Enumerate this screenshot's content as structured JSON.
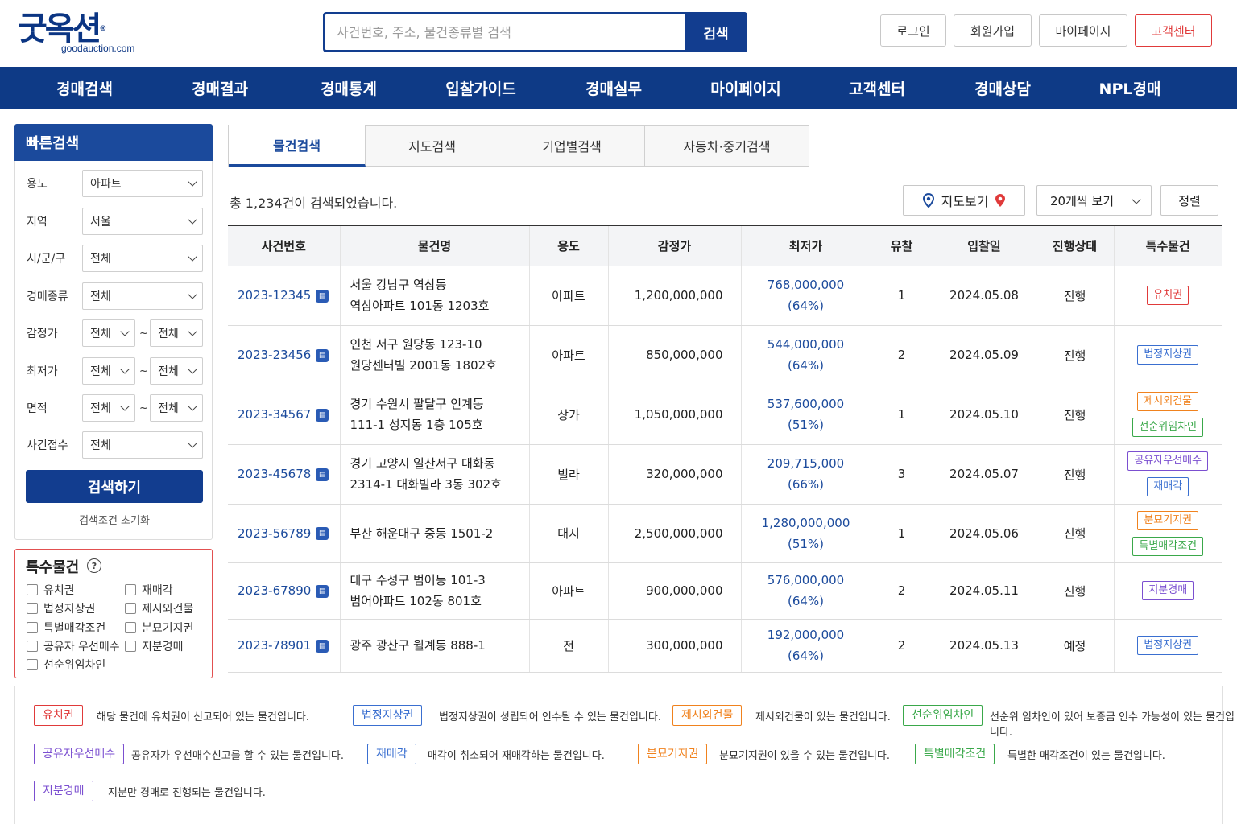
{
  "colors": {
    "brand_navy": "#0e3a86",
    "accent_blue": "#1b4a9c",
    "red": "#e03a3a",
    "tag_red": "#e03a3a",
    "tag_blue": "#3a6fd0",
    "tag_orange": "#f0821e",
    "tag_green": "#3aa84a",
    "tag_purple": "#7b4fd0"
  },
  "header": {
    "logo_main": "굿옥션",
    "logo_reg": "®",
    "logo_sub": "goodauction.com",
    "search_placeholder": "사건번호, 주소, 물건종류별 검색",
    "search_button": "검색",
    "login": "로그인",
    "signup": "회원가입",
    "mypage": "마이페이지",
    "support": "고객센터"
  },
  "nav": [
    "경매검색",
    "경매결과",
    "경매통계",
    "입찰가이드",
    "경매실무",
    "마이페이지",
    "고객센터",
    "경매상담",
    "NPL경매"
  ],
  "sidebar": {
    "title": "빠른검색",
    "usage_label": "용도",
    "usage_value": "아파트",
    "region_label": "지역",
    "region_value": "서울",
    "district_label": "시/군/구",
    "district_value": "전체",
    "type_label": "경매종류",
    "type_value": "전체",
    "appraisal_label": "감정가",
    "appraisal_from": "전체",
    "appraisal_to": "전체",
    "minprice_label": "최저가",
    "minprice_from": "전체",
    "minprice_to": "전체",
    "area_label": "면적",
    "area_from": "전체",
    "area_to": "전체",
    "received_label": "사건접수",
    "received_value": "전체",
    "tilde": "~",
    "search_button": "검색하기",
    "reset": "검색조건 초기화"
  },
  "special": {
    "title": "특수물건",
    "help_icon": "question-circle-icon",
    "items": [
      "유치권",
      "재매각",
      "법정지상권",
      "제시외건물",
      "특별매각조건",
      "분묘기지권",
      "공유자 우선매수",
      "지분경매",
      "선순위임차인"
    ]
  },
  "tabs": [
    "물건검색",
    "지도검색",
    "기업별검색",
    "자동차·중기검색"
  ],
  "toolbar": {
    "result_count": "총 1,234건이 검색되었습니다.",
    "map_view": "지도보기",
    "per_page": "20개씩 보기",
    "sort": "정렬"
  },
  "table": {
    "headers": [
      "사건번호",
      "물건명",
      "용도",
      "감정가",
      "최저가",
      "유찰",
      "입찰일",
      "진행상태",
      "특수물건"
    ],
    "rows": [
      {
        "case": "2023-12345",
        "name1": "서울 강남구 역삼동",
        "name2": "역삼아파트 101동 1203호",
        "usage": "아파트",
        "appraisal": "1,200,000,000",
        "min": "768,000,000",
        "pct": "(64%)",
        "fails": "1",
        "date": "2024.05.08",
        "status": "진행",
        "tags": [
          {
            "label": "유치권",
            "color": "red"
          }
        ]
      },
      {
        "case": "2023-23456",
        "name1": "인천 서구 원당동 123-10",
        "name2": "원당센터빌 2001동 1802호",
        "usage": "아파트",
        "appraisal": "850,000,000",
        "min": "544,000,000",
        "pct": "(64%)",
        "fails": "2",
        "date": "2024.05.09",
        "status": "진행",
        "tags": [
          {
            "label": "법정지상권",
            "color": "blue"
          }
        ]
      },
      {
        "case": "2023-34567",
        "name1": "경기 수원시 팔달구 인계동",
        "name2": "111-1 성지동 1층 105호",
        "usage": "상가",
        "appraisal": "1,050,000,000",
        "min": "537,600,000",
        "pct": "(51%)",
        "fails": "1",
        "date": "2024.05.10",
        "status": "진행",
        "tags": [
          {
            "label": "제시외건물",
            "color": "orange"
          },
          {
            "label": "선순위임차인",
            "color": "green"
          }
        ]
      },
      {
        "case": "2023-45678",
        "name1": "경기 고양시 일산서구 대화동",
        "name2": "2314-1 대화빌라 3동 302호",
        "usage": "빌라",
        "appraisal": "320,000,000",
        "min": "209,715,000",
        "pct": "(66%)",
        "fails": "3",
        "date": "2024.05.07",
        "status": "진행",
        "tags": [
          {
            "label": "공유자우선매수",
            "color": "purple"
          },
          {
            "label": "재매각",
            "color": "blue"
          }
        ]
      },
      {
        "case": "2023-56789",
        "name1": "부산 해운대구 중동 1501-2",
        "name2": "",
        "usage": "대지",
        "appraisal": "2,500,000,000",
        "min": "1,280,000,000",
        "pct": "(51%)",
        "fails": "1",
        "date": "2024.05.06",
        "status": "진행",
        "tags": [
          {
            "label": "분묘기지권",
            "color": "orange"
          },
          {
            "label": "특별매각조건",
            "color": "green"
          }
        ]
      },
      {
        "case": "2023-67890",
        "name1": "대구 수성구 범어동 101-3",
        "name2": "범어아파트 102동 801호",
        "usage": "아파트",
        "appraisal": "900,000,000",
        "min": "576,000,000",
        "pct": "(64%)",
        "fails": "2",
        "date": "2024.05.11",
        "status": "진행",
        "tags": [
          {
            "label": "지분경매",
            "color": "purple"
          }
        ]
      },
      {
        "case": "2023-78901",
        "name1": "광주 광산구 월계동 888-1",
        "name2": "",
        "usage": "전",
        "appraisal": "300,000,000",
        "min": "192,000,000",
        "pct": "(64%)",
        "fails": "2",
        "date": "2024.05.13",
        "status": "예정",
        "tags": [
          {
            "label": "법정지상권",
            "color": "blue"
          }
        ]
      }
    ]
  },
  "legend": [
    {
      "label": "유치권",
      "color": "red",
      "desc": "해당 물건에 유치권이 신고되어 있는 물건입니다."
    },
    {
      "label": "법정지상권",
      "color": "blue",
      "desc": "법정지상권이 성립되어 인수될 수 있는 물건입니다."
    },
    {
      "label": "제시외건물",
      "color": "orange",
      "desc": "제시외건물이 있는 물건입니다."
    },
    {
      "label": "선순위임차인",
      "color": "green",
      "desc": "선순위 임차인이 있어 보증금 인수 가능성이 있는 물건입니다."
    },
    {
      "label": "공유자우선매수",
      "color": "purple",
      "desc": "공유자가 우선매수신고를 할 수 있는 물건입니다."
    },
    {
      "label": "재매각",
      "color": "blue",
      "desc": "매각이 취소되어 재매각하는 물건입니다."
    },
    {
      "label": "분묘기지권",
      "color": "orange",
      "desc": "분묘기지권이 있을 수 있는 물건입니다."
    },
    {
      "label": "특별매각조건",
      "color": "green",
      "desc": "특별한 매각조건이 있는 물건입니다."
    },
    {
      "label": "지분경매",
      "color": "purple",
      "desc": "지분만 경매로 진행되는 물건입니다."
    }
  ]
}
